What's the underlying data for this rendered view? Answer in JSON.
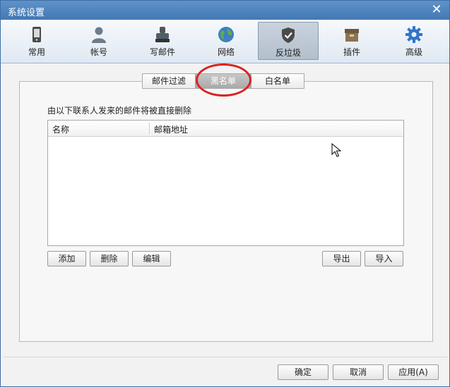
{
  "window": {
    "title": "系统设置"
  },
  "toolbar": {
    "items": [
      {
        "label": "常用",
        "icon": "phone-icon"
      },
      {
        "label": "帐号",
        "icon": "user-icon"
      },
      {
        "label": "写邮件",
        "icon": "write-mail-icon"
      },
      {
        "label": "网络",
        "icon": "globe-icon"
      },
      {
        "label": "反垃圾",
        "icon": "shield-icon",
        "active": true
      },
      {
        "label": "插件",
        "icon": "box-icon"
      },
      {
        "label": "高级",
        "icon": "gear-icon"
      }
    ]
  },
  "subtabs": [
    {
      "label": "邮件过滤"
    },
    {
      "label": "黑名单",
      "active": true
    },
    {
      "label": "白名单"
    }
  ],
  "blacklist": {
    "description": "由以下联系人发来的邮件将被直接删除",
    "columns": [
      "名称",
      "邮箱地址"
    ],
    "rows": []
  },
  "buttons": {
    "add": "添加",
    "delete": "删除",
    "edit": "编辑",
    "export": "导出",
    "import": "导入"
  },
  "footer": {
    "ok": "确定",
    "cancel": "取消",
    "apply": "应用(A)"
  },
  "colors": {
    "titlebar": "#4a7db7",
    "highlight_circle": "#d92323"
  }
}
